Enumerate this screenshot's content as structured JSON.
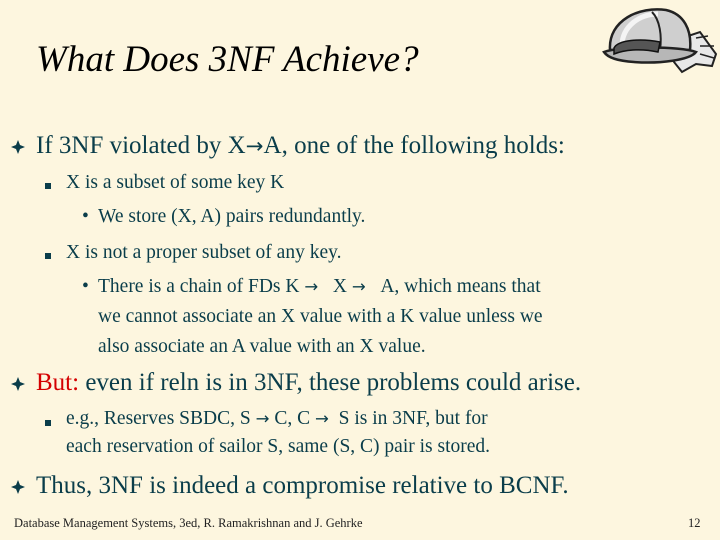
{
  "title": "What Does 3NF Achieve?",
  "b1": {
    "text_a": "If 3NF violated by X",
    "arrow": "→",
    "text_b": "A, one of the following holds:",
    "sub1": "X is a subset of some key K",
    "sub1_dot": "We store (X, A) pairs redundantly.",
    "sub2": "X is not a proper subset of any key.",
    "sub2_dot": {
      "a": "There is a chain of FDs  K",
      "b": "X",
      "c": "A, which means that",
      "line2": "we cannot associate an X value with a K value unless we",
      "line3": "also associate an A value with an X value."
    }
  },
  "b2": {
    "label": "But:",
    "text": "even if reln is in 3NF, these problems could arise.",
    "sub": {
      "a": "e.g., Reserves  SBDC,  S",
      "b": "C,   C",
      "c": "S   is in 3NF, but for",
      "line2": "each reservation of sailor S,  same (S, C) pair is stored."
    }
  },
  "b3": {
    "text": "Thus, 3NF is indeed a compromise relative to BCNF."
  },
  "footer": {
    "left": "Database Management Systems, 3ed, R. Ramakrishnan and J. Gehrke",
    "page": "12"
  },
  "icons": {
    "bullet": "diamond-bullet-icon",
    "logo": "hardhat-gloves-icon"
  },
  "colors": {
    "text": "#0a3d4a",
    "accent": "#d40000",
    "background": "#fdf6df"
  }
}
